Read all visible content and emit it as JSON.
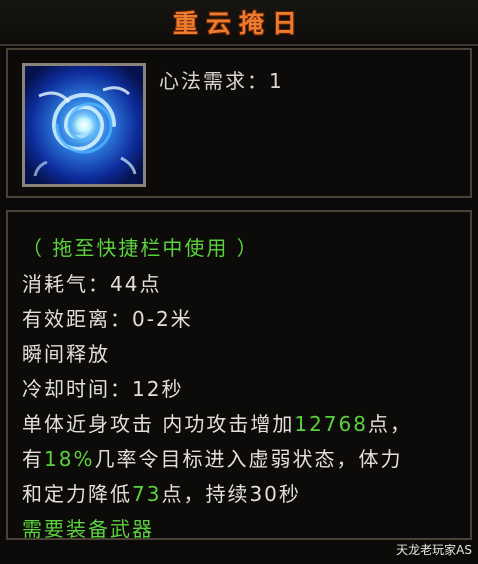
{
  "title": "重云掩日",
  "requirement": "心法需求：1",
  "icon": "blue-swirl-skill-icon",
  "usage_hint": "（ 拖至快捷栏中使用 ）",
  "stats": {
    "cost": "消耗气：44点",
    "range": "有效距离：0-2米",
    "cast": "瞬间释放",
    "cooldown": "冷却时间：12秒"
  },
  "description": {
    "l1_a": "单体近身攻击 内功攻击增加",
    "l1_num": "12768",
    "l1_b": "点，",
    "l2_a": "有",
    "l2_num": "18%",
    "l2_b": "几率令目标进入虚弱状态，体力",
    "l3_a": "和定力降低",
    "l3_num": "73",
    "l3_b": "点，持续30秒"
  },
  "weapon_requirement": "需要装备武器",
  "watermark": "天龙老玩家AS",
  "colors": {
    "title": "#ee7a2e",
    "highlight_green": "#5bd13d",
    "text": "#e2e0d8"
  }
}
